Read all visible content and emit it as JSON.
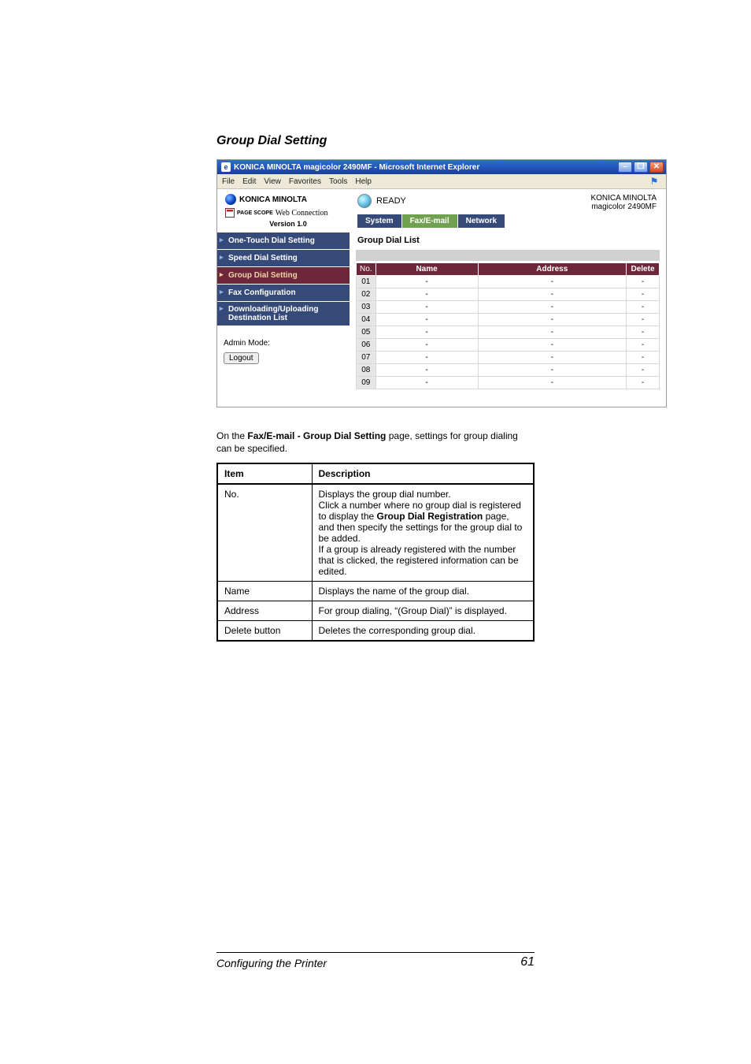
{
  "section_heading": "Group Dial Setting",
  "ie": {
    "title": "KONICA MINOLTA magicolor 2490MF - Microsoft Internet Explorer",
    "menu": [
      "File",
      "Edit",
      "View",
      "Favorites",
      "Tools",
      "Help"
    ]
  },
  "brand": {
    "logo_text": "KONICA MINOLTA",
    "pagescope_prefix": "PAGE SCOPE",
    "pagescope_label": "Web Connection",
    "version": "Version 1.0",
    "product_line1": "KONICA MINOLTA",
    "product_line2": "magicolor 2490MF"
  },
  "status": {
    "ready": "READY"
  },
  "tabs": {
    "system": "System",
    "faxemail": "Fax/E-mail",
    "network": "Network"
  },
  "sidebar": {
    "items": [
      {
        "label": "One-Touch Dial Setting"
      },
      {
        "label": "Speed Dial Setting"
      },
      {
        "label": "Group Dial Setting"
      },
      {
        "label": "Fax Configuration"
      },
      {
        "label": "Downloading/Uploading Destination List"
      }
    ],
    "admin_label": "Admin Mode:",
    "logout": "Logout"
  },
  "content": {
    "list_title": "Group Dial List",
    "headers": {
      "no": "No.",
      "name": "Name",
      "address": "Address",
      "delete": "Delete"
    },
    "rows": [
      {
        "no": "01",
        "name": "-",
        "address": "-",
        "delete": "-"
      },
      {
        "no": "02",
        "name": "-",
        "address": "-",
        "delete": "-"
      },
      {
        "no": "03",
        "name": "-",
        "address": "-",
        "delete": "-"
      },
      {
        "no": "04",
        "name": "-",
        "address": "-",
        "delete": "-"
      },
      {
        "no": "05",
        "name": "-",
        "address": "-",
        "delete": "-"
      },
      {
        "no": "06",
        "name": "-",
        "address": "-",
        "delete": "-"
      },
      {
        "no": "07",
        "name": "-",
        "address": "-",
        "delete": "-"
      },
      {
        "no": "08",
        "name": "-",
        "address": "-",
        "delete": "-"
      },
      {
        "no": "09",
        "name": "-",
        "address": "-",
        "delete": "-"
      }
    ]
  },
  "caption": {
    "pre": "On the ",
    "bold": "Fax/E-mail - Group Dial Setting",
    "post": " page, settings for group dialing can be specified."
  },
  "spec": {
    "header_item": "Item",
    "header_desc": "Description",
    "rows": {
      "no_item": "No.",
      "no_line1": "Displays the group dial number.",
      "no_line2a": "Click a number where no group dial is registered to display the ",
      "no_line2b": "Group Dial Registration",
      "no_line2c": " page, and then specify the settings for the group dial to be added.",
      "no_line3": "If a group is already registered with the number that is clicked, the registered information can be edited.",
      "name_item": "Name",
      "name_desc": "Displays the name of the group dial.",
      "addr_item": "Address",
      "addr_desc": "For group dialing, “(Group Dial)” is displayed.",
      "del_item": "Delete button",
      "del_desc": "Deletes the corresponding group dial."
    }
  },
  "footer": {
    "title": "Configuring the Printer",
    "page": "61"
  }
}
